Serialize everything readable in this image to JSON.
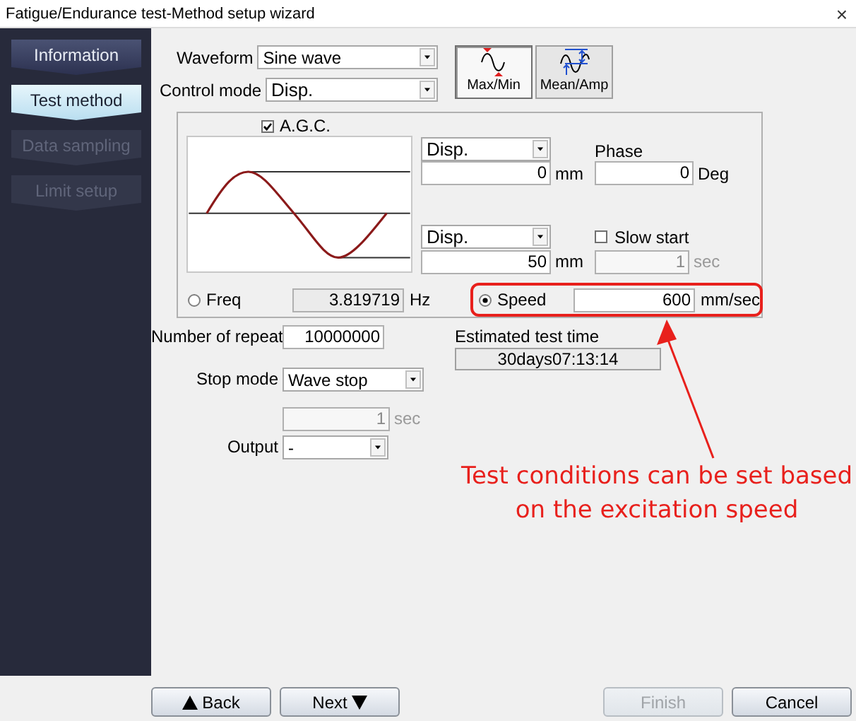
{
  "window": {
    "title": "Fatigue/Endurance test-Method setup wizard",
    "close": "×"
  },
  "sidebar": {
    "items": [
      {
        "label": "Information",
        "selected": false,
        "disabled": false
      },
      {
        "label": "Test method",
        "selected": true,
        "disabled": false
      },
      {
        "label": "Data sampling",
        "selected": false,
        "disabled": true
      },
      {
        "label": "Limit setup",
        "selected": false,
        "disabled": true
      }
    ]
  },
  "waveform": {
    "label": "Waveform",
    "value": "Sine wave"
  },
  "control_mode": {
    "label": "Control mode",
    "value": "Disp."
  },
  "modes": [
    {
      "label": "Max/Min",
      "selected": true
    },
    {
      "label": "Mean/Amp",
      "selected": false
    }
  ],
  "agc": {
    "label": "A.G.C.",
    "checked": true
  },
  "upper": {
    "select": "Disp.",
    "value": "0",
    "unit": "mm"
  },
  "phase": {
    "label": "Phase",
    "value": "0",
    "unit": "Deg"
  },
  "lower": {
    "select": "Disp.",
    "value": "50",
    "unit": "mm"
  },
  "slow_start": {
    "label": "Slow start",
    "checked": false,
    "value": "1",
    "unit": "sec",
    "disabled": true
  },
  "rate_options": [
    {
      "label": "Freq",
      "selected": false,
      "highlighted": false,
      "value": "3.819719",
      "unit": "Hz"
    },
    {
      "label": "Speed",
      "selected": true,
      "highlighted": true,
      "value": "600",
      "unit": "mm/sec"
    }
  ],
  "repeat": {
    "label": "Number of repeat",
    "value": "10000000"
  },
  "estimated": {
    "label": "Estimated test time",
    "value": "30days07:13:14"
  },
  "stop_mode": {
    "label": "Stop mode",
    "value": "Wave stop",
    "delay": {
      "value": "1",
      "unit": "sec",
      "disabled": true
    }
  },
  "output": {
    "label": "Output",
    "value": "-"
  },
  "annotation": {
    "lines": [
      "Test conditions can be set based",
      "on the excitation speed"
    ]
  },
  "buttons": [
    {
      "label": "Back",
      "kind": "back",
      "disabled": false
    },
    {
      "label": "Next",
      "kind": "next",
      "disabled": false
    },
    {
      "label": "Finish",
      "kind": "plain",
      "disabled": true
    },
    {
      "label": "Cancel",
      "kind": "plain",
      "disabled": false
    }
  ]
}
